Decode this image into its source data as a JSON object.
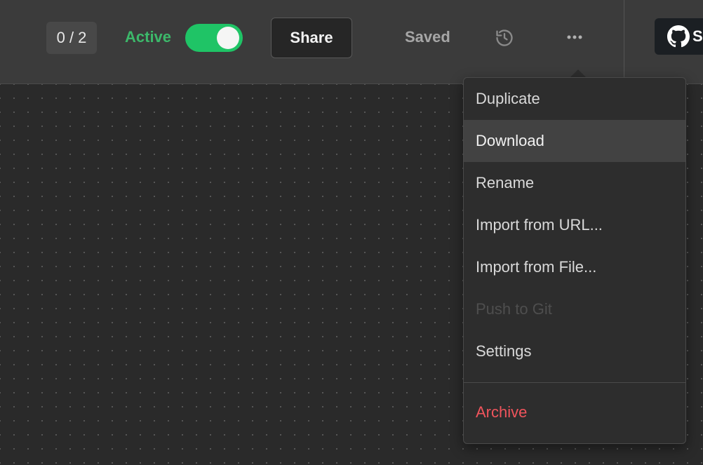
{
  "header": {
    "counter": "0 / 2",
    "active_label": "Active",
    "active_toggle_on": true,
    "share_label": "Share",
    "saved_label": "Saved",
    "history_icon": "history-icon",
    "more_icon": "more-horizontal-icon",
    "github_icon": "github-icon",
    "github_label_partial": "S"
  },
  "menu": {
    "items": [
      {
        "label": "Duplicate",
        "state": "normal"
      },
      {
        "label": "Download",
        "state": "highlighted"
      },
      {
        "label": "Rename",
        "state": "normal"
      },
      {
        "label": "Import from URL...",
        "state": "normal"
      },
      {
        "label": "Import from File...",
        "state": "normal"
      },
      {
        "label": "Push to Git",
        "state": "disabled"
      },
      {
        "label": "Settings",
        "state": "normal"
      }
    ],
    "danger_item": {
      "label": "Archive"
    }
  },
  "colors": {
    "active_green": "#3cb86a",
    "toggle_green": "#1fc466",
    "danger_red": "#f0545c"
  }
}
